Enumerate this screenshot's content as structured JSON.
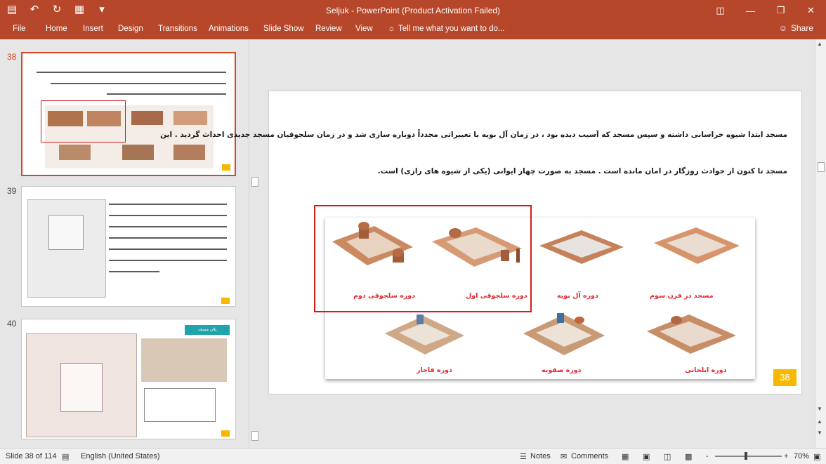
{
  "window": {
    "title": "Seljuk  -  PowerPoint (Product Activation Failed)"
  },
  "qat": {
    "save_icon": "save-icon",
    "undo_icon": "undo-icon",
    "redo_icon": "redo-icon",
    "presenter_icon": "slideshow-icon",
    "customize_icon": "customize-icon"
  },
  "ribbon": {
    "tabs": [
      "File",
      "Home",
      "Insert",
      "Design",
      "Transitions",
      "Animations",
      "Slide Show",
      "Review",
      "View"
    ],
    "tell_me": "Tell me what you want to do...",
    "share": "Share"
  },
  "thumbnails": [
    {
      "number": "38",
      "page": "38"
    },
    {
      "number": "39",
      "page": "39"
    },
    {
      "number": "40",
      "page": "40",
      "header": "پلان مسجد"
    }
  ],
  "slide": {
    "line1": "مسجد ابتدا شیوه خراسانی داشته و سپس مسجد که آسیب دیده بود ، در زمان آل بویه با تغییراتی مجدداً دوباره سازی شد و در زمان سلجوقیان مسجد جدیدی احداث گردید . این",
    "line2": "مسجد تا کنون از حوادث روزگار در امان مانده است . مسجد به صورت چهار ایوانی (یکی از شیوه های رازی) است.",
    "captions": {
      "c1": "مسجد در قرن سوم",
      "c2": "دوره آل بویه",
      "c3": "دوره سلجوقی اول",
      "c4": "دوره سلجوقی دوم",
      "c5": "دوره ایلخانی",
      "c6": "دوره صفویه",
      "c7": "دوره قاجار"
    },
    "page_number": "38"
  },
  "status": {
    "slide_info": "Slide 38 of 114",
    "language": "English (United States)",
    "notes": "Notes",
    "comments": "Comments",
    "zoom_minus": "-",
    "zoom_plus": "+",
    "zoom": "70%"
  },
  "colors": {
    "accent": "#b7472a",
    "highlight": "#d41a1a",
    "badge": "#f6b800",
    "caption": "#e5262e"
  }
}
